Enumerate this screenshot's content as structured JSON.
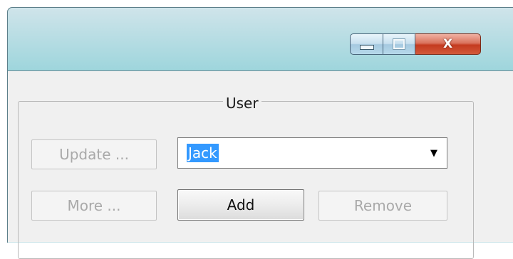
{
  "window": {
    "controls": {
      "minimize_icon": "minimize-icon",
      "maximize_icon": "maximize-icon",
      "close_label": "X"
    }
  },
  "group": {
    "title": "User"
  },
  "buttons": {
    "update": "Update ...",
    "more": "More ...",
    "add": "Add",
    "remove": "Remove"
  },
  "combo": {
    "value": "Jack",
    "arrow": "▼"
  },
  "colors": {
    "title_bar": "#8fd1d8",
    "close_button": "#c43a1f",
    "selection": "#3399ff",
    "disabled_text": "#a9a9a9"
  }
}
